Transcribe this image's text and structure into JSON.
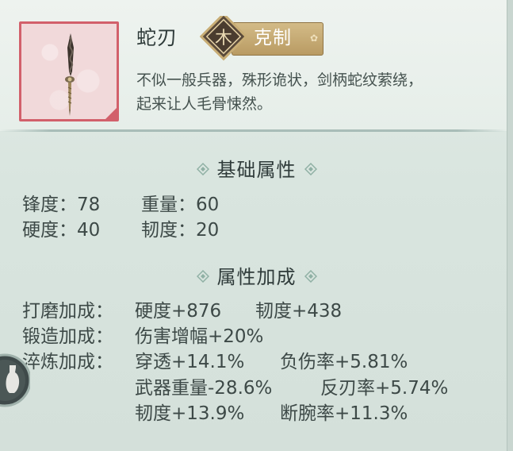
{
  "item": {
    "name": "蛇刃",
    "badge_label": "克制",
    "description_lines": [
      "不似一般兵器，殊形诡状，剑柄蛇纹萦绕，",
      "起来让人毛骨悚然。"
    ],
    "rarity_color": "#d2606b",
    "icon": "snake-blade-icon"
  },
  "basic_section": {
    "title": "基础属性",
    "stats": [
      {
        "label": "锋度：",
        "value": "78"
      },
      {
        "label": "重量：",
        "value": "60"
      },
      {
        "label": "硬度：",
        "value": "40"
      },
      {
        "label": "韧度：",
        "value": "20"
      }
    ]
  },
  "bonus_section": {
    "title": "属性加成",
    "rows": [
      {
        "label": "打磨加成：",
        "values": [
          "硬度+876",
          "韧度+438"
        ]
      },
      {
        "label": "锻造加成：",
        "values": [
          "伤害增幅+20%"
        ]
      },
      {
        "label": "淬炼加成：",
        "values": [
          "穿透+14.1%",
          "负伤率+5.81%"
        ]
      },
      {
        "label": "",
        "values": [
          "武器重量-28.6%",
          "反刃率+5.74%"
        ]
      },
      {
        "label": "",
        "values": [
          "韧度+13.9%",
          "断腕率+11.3%"
        ]
      }
    ]
  },
  "colors": {
    "text": "#2f3b3a",
    "badge_gold": "#c8ad75",
    "diamond": "#8fb0a4"
  }
}
